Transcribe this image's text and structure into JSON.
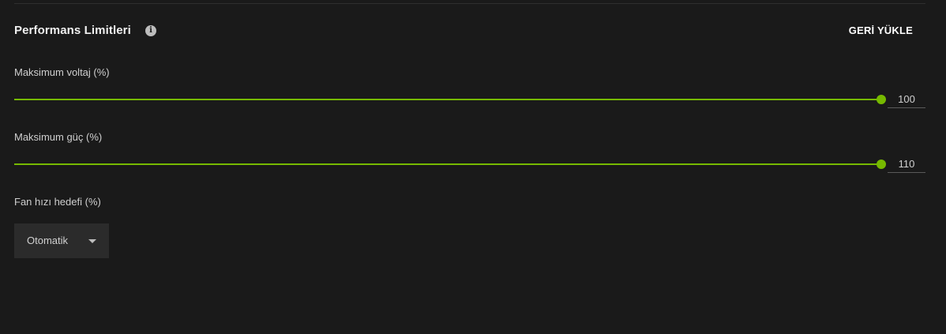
{
  "section": {
    "title": "Performans Limitleri",
    "info_icon": "i",
    "reset_label": "GERİ YÜKLE"
  },
  "sliders": [
    {
      "label": "Maksimum voltaj (%)",
      "value": "100",
      "fill_fraction": 1.0
    },
    {
      "label": "Maksimum güç (%)",
      "value": "110",
      "fill_fraction": 1.0
    }
  ],
  "fan": {
    "label": "Fan hızı hedefi (%)",
    "selected": "Otomatik"
  },
  "colors": {
    "accent": "#76b900",
    "background": "#1a1a1a"
  }
}
